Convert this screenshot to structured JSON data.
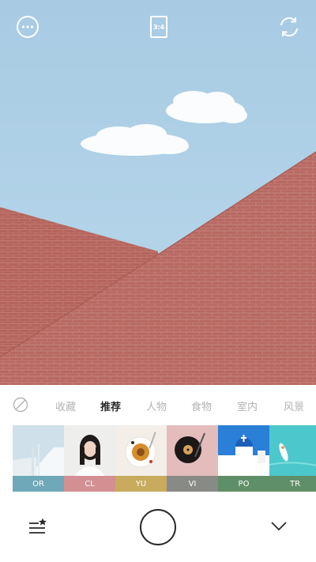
{
  "toolbar": {
    "more_icon": "more-horizontal-icon",
    "aspect_ratio": "3:4",
    "flip_icon": "camera-flip-icon"
  },
  "categories": {
    "none_icon": "no-filter-icon",
    "items": [
      {
        "label": "收藏",
        "active": false
      },
      {
        "label": "推荐",
        "active": true
      },
      {
        "label": "人物",
        "active": false
      },
      {
        "label": "食物",
        "active": false
      },
      {
        "label": "室内",
        "active": false
      },
      {
        "label": "风景",
        "active": false
      }
    ]
  },
  "filters": [
    {
      "code": "OR",
      "color": "#6fa9b9"
    },
    {
      "code": "CL",
      "color": "#d48f93"
    },
    {
      "code": "YU",
      "color": "#c9ab5e"
    },
    {
      "code": "VI",
      "color": "#888a86"
    },
    {
      "code": "PO",
      "color": "#5f8f69"
    },
    {
      "code": "TR",
      "color": "#5f8f69"
    }
  ],
  "bottom": {
    "filters_icon": "filter-list-star-icon",
    "shutter_icon": "shutter-button",
    "collapse_icon": "chevron-down-icon"
  },
  "colors": {
    "sky": "#b0d1e6",
    "brick": "#b96a62",
    "text_active": "#2b2b2b",
    "text_inactive": "#b4b4b4"
  }
}
